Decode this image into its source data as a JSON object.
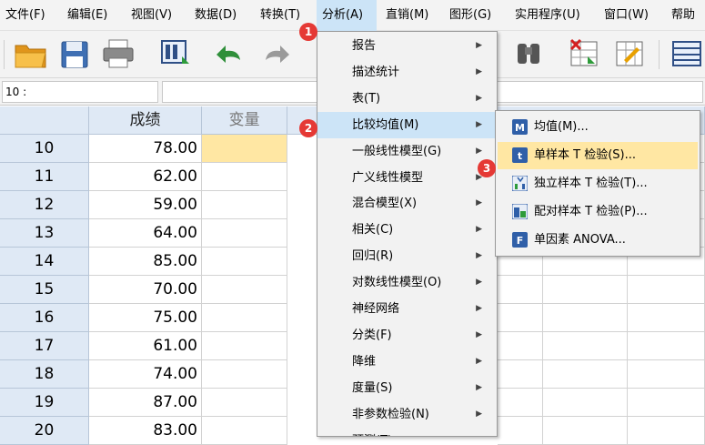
{
  "menubar": {
    "items": [
      "文件(F)",
      "编辑(E)",
      "视图(V)",
      "数据(D)",
      "转换(T)",
      "分析(A)",
      "直销(M)",
      "图形(G)",
      "实用程序(U)",
      "窗口(W)",
      "帮助"
    ]
  },
  "cellbar": {
    "ref": "10 :",
    "value": ""
  },
  "grid": {
    "headers": [
      "成绩",
      "变量"
    ],
    "rows": [
      {
        "num": "10",
        "val": "78.00"
      },
      {
        "num": "11",
        "val": "62.00"
      },
      {
        "num": "12",
        "val": "59.00"
      },
      {
        "num": "13",
        "val": "64.00"
      },
      {
        "num": "14",
        "val": "85.00"
      },
      {
        "num": "15",
        "val": "70.00"
      },
      {
        "num": "16",
        "val": "75.00"
      },
      {
        "num": "17",
        "val": "61.00"
      },
      {
        "num": "18",
        "val": "74.00"
      },
      {
        "num": "19",
        "val": "87.00"
      },
      {
        "num": "20",
        "val": "83.00"
      }
    ]
  },
  "analyze_menu": {
    "items": [
      "报告",
      "描述统计",
      "表(T)",
      "比较均值(M)",
      "一般线性模型(G)",
      "广义线性模型",
      "混合模型(X)",
      "相关(C)",
      "回归(R)",
      "对数线性模型(O)",
      "神经网络",
      "分类(F)",
      "降维",
      "度量(S)",
      "非参数检验(N)",
      "预测(T)"
    ],
    "arrow": "▶"
  },
  "compare_means_menu": {
    "items": [
      {
        "label": "均值(M)...",
        "icon": "means-icon"
      },
      {
        "label": "单样本 T 检验(S)...",
        "icon": "one-sample-t-icon"
      },
      {
        "label": "独立样本 T 检验(T)...",
        "icon": "independent-t-icon"
      },
      {
        "label": "配对样本 T 检验(P)...",
        "icon": "paired-t-icon"
      },
      {
        "label": "单因素 ANOVA...",
        "icon": "anova-icon"
      }
    ]
  },
  "badges": [
    "1",
    "2",
    "3"
  ],
  "colors": {
    "menu_highlight": "#cce4f7",
    "selection": "#ffe7a3",
    "header_bg": "#dfe9f5",
    "badge": "#e53935"
  }
}
